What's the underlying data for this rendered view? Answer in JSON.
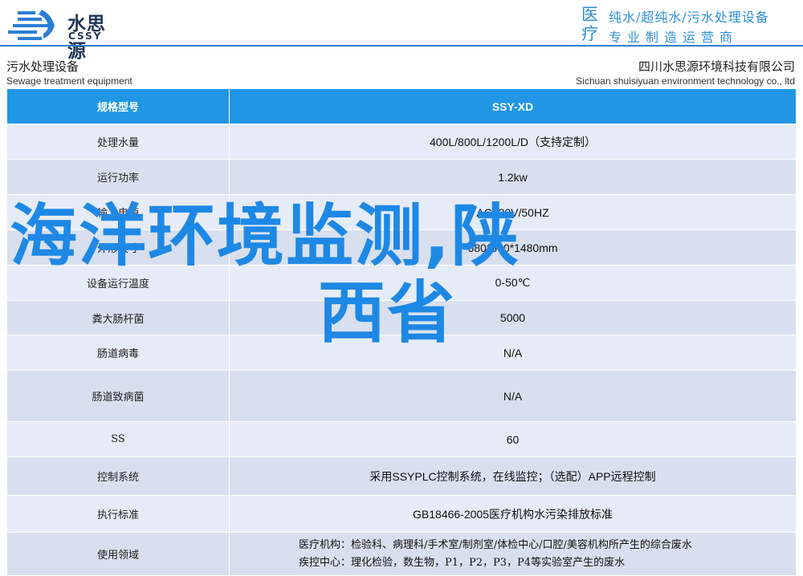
{
  "header": {
    "logo_cn": "水思源",
    "logo_en": "CSSY",
    "brand_big": "医疗",
    "brand_line1": "纯水/超纯水/污水处理设备",
    "brand_line2": "专业制造运营商",
    "accent_color": "#2b7fd4"
  },
  "subtitle": {
    "left_cn": "污水处理设备",
    "left_en": "Sewage treatment equipment",
    "right_cn": "四川水思源环境科技有限公司",
    "right_en": "Sichuan shuisiyuan environment technology co., ltd"
  },
  "table": {
    "header": {
      "key": "规格型号",
      "value": "SSY-XD"
    },
    "rows": [
      {
        "key": "处理水量",
        "value": "400L/800L/1200L/D（支持定制）"
      },
      {
        "key": "运行功率",
        "value": "1.2kw"
      },
      {
        "key": "输入电源",
        "value": "AC220V/50HZ"
      },
      {
        "key": "外形尺寸",
        "value": "680*560*1480mm"
      },
      {
        "key": "设备运行温度",
        "value": "0-50℃"
      },
      {
        "key": "粪大肠杆菌",
        "value": "5000"
      },
      {
        "key": "肠道病毒",
        "value": "N/A"
      },
      {
        "key": "肠道致病菌",
        "value": "N/A"
      },
      {
        "key": "SS",
        "value": "60"
      },
      {
        "key": "控制系统",
        "value": "采用SSYPLC控制系统，在线监控；（选配）APP远程控制"
      },
      {
        "key": "执行标准",
        "value": "GB18466-2005医疗机构水污染排放标准"
      },
      {
        "key": "使用领域",
        "value_line1": "医疗机构：检验科、病理科/手术室/制剂室/体检中心/口腔/美容机构所产生的综合废水",
        "value_line2": "疾控中心：理化检验，数生物，P1，P2，P3，P4等实验室产生的废水"
      }
    ],
    "header_color": "#2196e4",
    "row_color_a": "#e6ecf7",
    "row_color_b": "#d8e0ef"
  },
  "overlay": {
    "line1": "海洋环境监测,陕",
    "line2": "西省",
    "color": "#1e88e5"
  }
}
